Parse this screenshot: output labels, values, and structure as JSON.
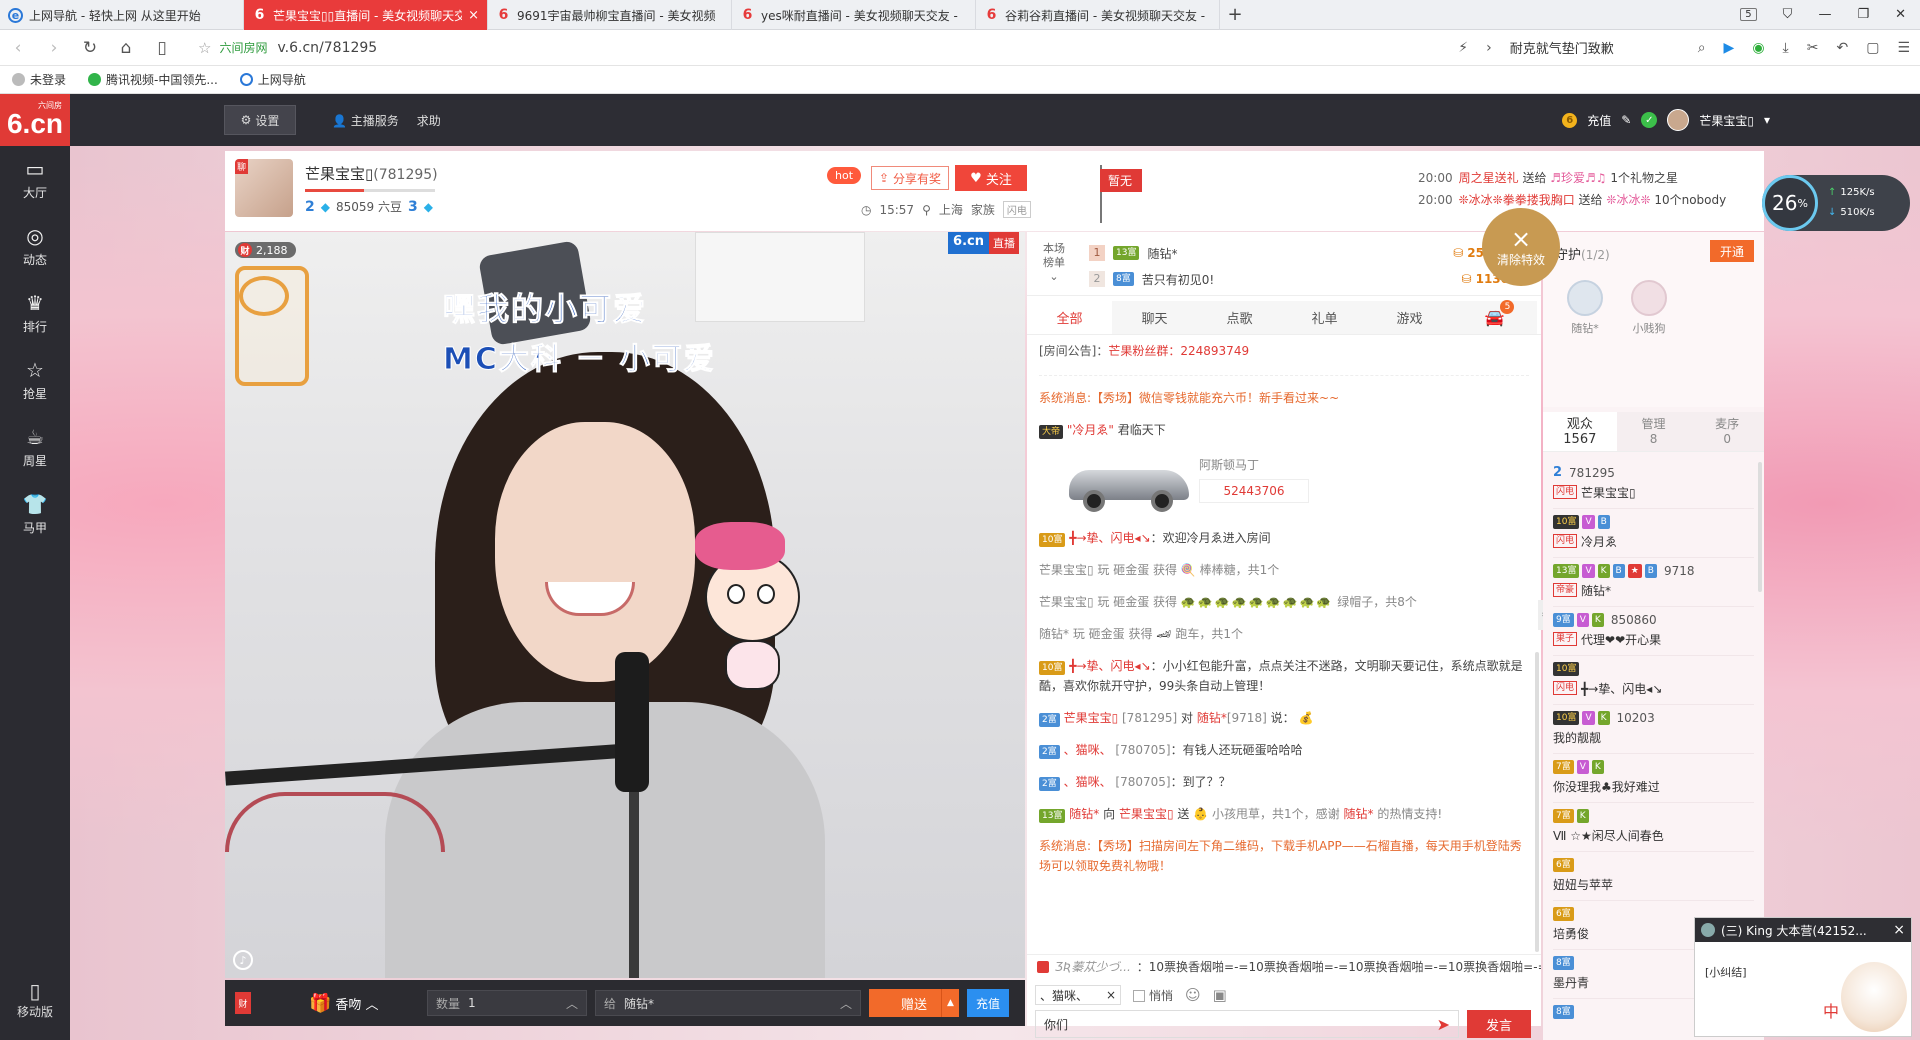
{
  "browser": {
    "tabs": [
      {
        "title": "上网导航 - 轻快上网 从这里开始",
        "icon": "globe-e-icon",
        "active": false
      },
      {
        "title": "芒果宝宝▯▯直播间 - 美女视频聊天交友",
        "icon": "six-icon",
        "active": true,
        "close": "×"
      },
      {
        "title": "9691宇宙最帅柳宝直播间 - 美女视频",
        "icon": "six-icon",
        "active": false
      },
      {
        "title": "yes咪耐直播间 - 美女视频聊天交友 -",
        "icon": "six-icon",
        "active": false
      },
      {
        "title": "谷莉谷莉直播间 - 美女视频聊天交友 -",
        "icon": "six-icon",
        "active": false
      }
    ],
    "new_tab": "+",
    "tab_count": "5",
    "url_site_label": "六间房网",
    "url": "v.6.cn/781295",
    "search_hint": "耐克就气垫门致歉",
    "bookmarks": [
      "未登录",
      "腾讯视频-中国领先...",
      "上网导航"
    ]
  },
  "site": {
    "logo_text": "6.cn",
    "logo_sub": "六间房",
    "settings_label": "设置",
    "links": [
      "主播服务",
      "求助"
    ],
    "recharge": "充值",
    "coin_symbol": "6",
    "username": "芒果宝宝▯"
  },
  "sidenav": [
    {
      "label": "大厅",
      "icon": "tv-icon",
      "glyph": "▭"
    },
    {
      "label": "动态",
      "icon": "compass-icon",
      "glyph": "◎"
    },
    {
      "label": "排行",
      "icon": "crown-icon",
      "glyph": "♛"
    },
    {
      "label": "抢星",
      "icon": "star-icon",
      "glyph": "☆"
    },
    {
      "label": "周星",
      "icon": "cup-icon",
      "glyph": "☕"
    },
    {
      "label": "马甲",
      "icon": "shirt-icon",
      "glyph": "👕"
    }
  ],
  "sidenav_bottom": {
    "label": "移动版",
    "glyph": "▯"
  },
  "anchor": {
    "name": "芒果宝宝▯",
    "room_id": "(781295)",
    "level": "2",
    "beans": "85059 六豆",
    "fan_level": "3",
    "progress_fraction": 0.45,
    "tag": "聊",
    "hot": "hot",
    "share": "分享有奖",
    "follow": "关注",
    "time": "15:57",
    "city": "上海",
    "family_label": "家族",
    "family_tag": "闪电"
  },
  "flag": {
    "label": "暂无"
  },
  "news": [
    {
      "time": "20:00",
      "a": "周之星送礼",
      "b": "送给",
      "c": "♬珍爱♬♫",
      "d": "1个礼物之星"
    },
    {
      "time": "20:00",
      "a": "❊冰冰❊拳拳搂我胸口",
      "b": "送给",
      "c": "❊冰冰❊",
      "d": "10个nobody"
    }
  ],
  "video": {
    "line1": "嘿我的小可爱",
    "line2": "MC大科 － 小可爱",
    "wealth_count": "2,188",
    "wealth_tag": "财",
    "logo": "6.cn",
    "live": "直播",
    "mic_icon": "mic-icon"
  },
  "giftbar": {
    "cal_tag": "财",
    "gift_name": "香吻",
    "qty_label": "数量",
    "qty_value": "1",
    "to_label": "给",
    "to_value": "随钻*",
    "send": "赠送",
    "recharge": "充值"
  },
  "rank": {
    "label": "本场榜单",
    "rows": [
      {
        "no": "1",
        "badge": "13富",
        "name": "随钻*",
        "score": "25872"
      },
      {
        "no": "2",
        "badge": "8富",
        "name": "苦只有初见0!",
        "score": "1130"
      }
    ]
  },
  "clear_effects": {
    "x": "×",
    "label": "清除特效"
  },
  "chat_tabs": [
    "全部",
    "聊天",
    "点歌",
    "礼单",
    "游戏"
  ],
  "car_badge": "5",
  "notice": {
    "prefix": "[房间公告]：",
    "text": "芒果粉丝群：224893749"
  },
  "messages": {
    "sys1": "系统消息:【秀场】微信零钱就能充六币！新手看过来~~",
    "car_user": "\"冷月ゑ\"",
    "car_user_suffix": "君临天下",
    "car_user_badge": "大帝",
    "car_name": "阿斯顿马丁",
    "car_id": "52443706",
    "m1_user": "╋→挚、闪电◂↘",
    "m1_text": "：欢迎冷月ゑ进入房间",
    "m2": "芒果宝宝▯ 玩 砸金蛋 获得",
    "m2_item": "棒棒糖，共1个",
    "m3": "芒果宝宝▯ 玩 砸金蛋 获得",
    "m3_emoji": "🐢🐢🐢🐢🐢🐢🐢🐢🐢",
    "m3_item": "绿帽子，共8个",
    "m4": "随钻* 玩 砸金蛋 获得",
    "m4_item": "跑车，共1个",
    "m5_user": "╋→挚、闪电◂↘",
    "m5_text": "：小小红包能升富，点点关注不迷路，文明聊天要记住，系统点歌就是酷，喜欢你就开守护，99头条自动上管理！",
    "m6_user": "芒果宝宝▯",
    "m6_id": "[781295]",
    "m6_mid": "对",
    "m6_to": "随钻*",
    "m6_toid": "[9718]",
    "m6_end": "说：",
    "m7_user": "、猫咪、",
    "m7_id": "[780705]",
    "m7_text": "：有钱人还玩砸蛋哈哈哈",
    "m8_user": "、猫咪、",
    "m8_id": "[780705]",
    "m8_text": "：到了？？",
    "m9_user": "随钻*",
    "m9_a": "向",
    "m9_to": "芒果宝宝▯",
    "m9_b": "送",
    "m9_c": "小孩甩草，共1个，感谢",
    "m9_d": "随钻*",
    "m9_e": "的热情支持!",
    "sys2": "系统消息:【秀场】扫描房间左下角二维码，下载手机APP——石榴直播，每天用手机登陆秀场可以领取免费礼物哦！"
  },
  "ticker": {
    "name": "ƷƦ蓁苁少づ...",
    "text": "：10票换香烟啪=-=10票换香烟啪=-=10票换香烟啪=-=10票换香烟啪=-=10"
  },
  "chat_tools": {
    "to": "、猫咪、",
    "to_x": "×",
    "whisper": "悄悄"
  },
  "chat_input": {
    "value": "你们",
    "send": "发言"
  },
  "guard": {
    "title": "守护",
    "count": "(1/2)",
    "open": "开通",
    "members": [
      "随钻*",
      "小贱狗"
    ]
  },
  "user_tabs": [
    {
      "label": "观众",
      "count": "1567"
    },
    {
      "label": "管理",
      "count": "8"
    },
    {
      "label": "麦序",
      "count": "0"
    }
  ],
  "users": [
    {
      "l1": [
        "2"
      ],
      "id": "781295",
      "tag": "闪电",
      "name": "芒果宝宝▯"
    },
    {
      "l1": [
        "10富",
        "V",
        "B"
      ],
      "id": "",
      "tag": "闪电",
      "name": "冷月ゑ"
    },
    {
      "l1": [
        "13富",
        "V",
        "K",
        "B",
        "★",
        "B"
      ],
      "id": "9718",
      "tag": "帝豪",
      "name": "随钻*"
    },
    {
      "l1": [
        "9富",
        "V",
        "K"
      ],
      "id": "850860",
      "tag": "果子",
      "name": "代理❤❤开心果"
    },
    {
      "l1": [
        "10富"
      ],
      "id": "",
      "tag": "闪电",
      "name": "╋→挚、闪电◂↘"
    },
    {
      "l1": [
        "10富",
        "V",
        "K"
      ],
      "id": "10203",
      "tag": "",
      "name": "我的靓靓"
    },
    {
      "l1": [
        "7富",
        "V",
        "K"
      ],
      "id": "",
      "tag": "",
      "name": "你没理我♣我好难过"
    },
    {
      "l1": [
        "7富",
        "K"
      ],
      "id": "",
      "tag": "",
      "name": "Ⅶ ☆★闲尽人间春色"
    },
    {
      "l1": [
        "6富"
      ],
      "id": "",
      "tag": "",
      "name": "妞妞与苹苹"
    },
    {
      "l1": [
        "6富"
      ],
      "id": "",
      "tag": "",
      "name": "培勇俊"
    },
    {
      "l1": [
        "8富"
      ],
      "id": "",
      "tag": "",
      "name": "墨丹青"
    },
    {
      "l1": [
        "8富"
      ],
      "id": "",
      "tag": "",
      "name": ""
    }
  ],
  "speed": {
    "percent": "26",
    "unit": "%",
    "up": "125K/s",
    "down": "510K/s"
  },
  "popup": {
    "title": "(三) King 大本营(42152...",
    "close": "×",
    "body": "[小纠结]",
    "ime": "中"
  },
  "colors": {
    "brand_red": "#e03a36",
    "orange": "#f26a2a",
    "dark": "#2d2d34",
    "blue": "#2b8ff0"
  }
}
